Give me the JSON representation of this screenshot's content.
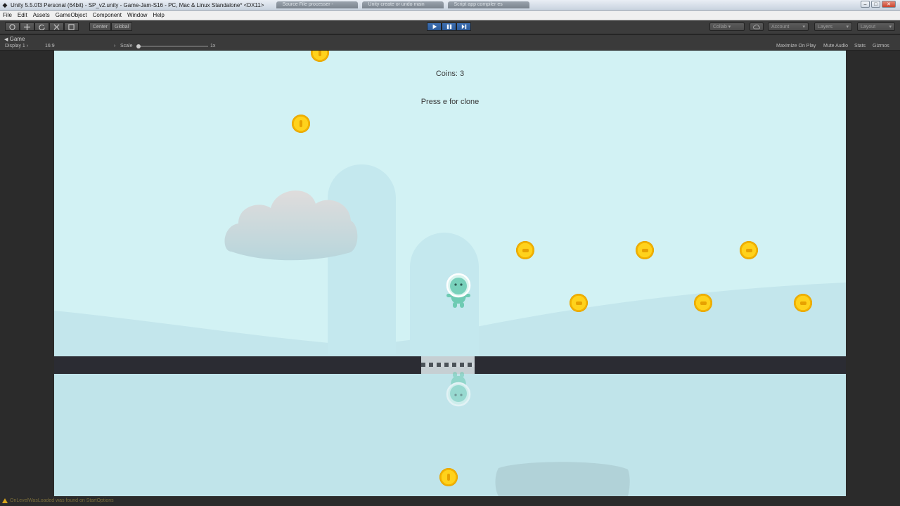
{
  "window": {
    "title": "Unity 5.5.0f3 Personal (64bit) - SP_v2.unity - Game-Jam-S16 - PC, Mac & Linux Standalone* <DX11>",
    "tabs": [
      "Source File processer -",
      "Unity create or undo main",
      "Script app compiler es"
    ],
    "buttons": {
      "minimize": "‒",
      "maximize": "□",
      "close": "✕"
    }
  },
  "menu": [
    "File",
    "Edit",
    "Assets",
    "GameObject",
    "Component",
    "Window",
    "Help"
  ],
  "toolbar": {
    "pivot": "Center",
    "space": "Global",
    "collab": "Collab ▾",
    "account": "Account",
    "layers": "Layers",
    "layout": "Layout",
    "dropdown_arrow": "▾"
  },
  "panel": {
    "tab_label": "Game",
    "tab_icon": "game-controller-icon"
  },
  "gamebar": {
    "display": "Display 1",
    "aspect": "16:9",
    "scale_label": "Scale",
    "scale_value": "1x",
    "maximize_on_play": "Maximize On Play",
    "mute_audio": "Mute Audio",
    "stats": "Stats",
    "gizmos": "Gizmos"
  },
  "game": {
    "coins_text": "Coins: 3",
    "hint_text": "Press e for clone",
    "colors": {
      "sky": "#d2f2f4",
      "floor": "#2b2c33",
      "coin": "#ffd21c",
      "player": "#6ecbb3"
    }
  },
  "status": {
    "message": "OnLevelWasLoaded was found on StartOptions"
  }
}
